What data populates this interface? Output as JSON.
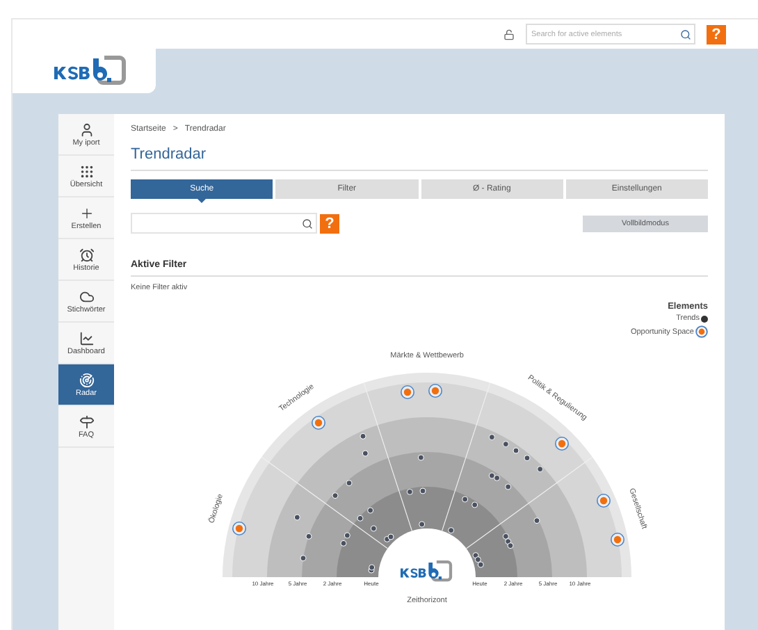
{
  "header": {
    "search": {
      "placeholder": "Search for active elements"
    },
    "help": "?"
  },
  "sidebar": {
    "items": [
      {
        "label": "My iport",
        "selected": false
      },
      {
        "label": "Übersicht",
        "selected": false
      },
      {
        "label": "Erstellen",
        "selected": false
      },
      {
        "label": "Historie",
        "selected": false
      },
      {
        "label": "Stichwörter",
        "selected": false
      },
      {
        "label": "Dashboard",
        "selected": false
      },
      {
        "label": "Radar",
        "selected": true
      },
      {
        "label": "FAQ",
        "selected": false
      }
    ]
  },
  "breadcrumb": [
    "Startseite",
    ">",
    "Trendradar"
  ],
  "title": "Trendradar",
  "tabs": [
    {
      "label": "Suche",
      "selected": true
    },
    {
      "label": "Filter",
      "selected": false
    },
    {
      "label": "Ø - Rating",
      "selected": false
    },
    {
      "label": "Einstellungen",
      "selected": false
    }
  ],
  "search": {
    "help": "?"
  },
  "fullscreen_button": "Vollbildmodus",
  "active_filters": {
    "heading": "Aktive Filter",
    "text": "Keine Filter aktiv"
  },
  "legend": {
    "title": "Elements",
    "items": [
      {
        "label": "Trends",
        "kind": "trend"
      },
      {
        "label": "Opportunity Space",
        "kind": "opportunity"
      }
    ]
  },
  "radar": {
    "sectors": [
      "Ökologie",
      "Technologie",
      "Märkte & Wettbewerb",
      "Politik & Regulierung",
      "Gesellschaft"
    ],
    "rings_left": [
      "10 Jahre",
      "5 Jahre",
      "2 Jahre",
      "Heute"
    ],
    "rings_right": [
      "Heute",
      "2 Jahre",
      "5 Jahre",
      "10 Jahre"
    ],
    "axis_label": "Zeithorizont"
  }
}
